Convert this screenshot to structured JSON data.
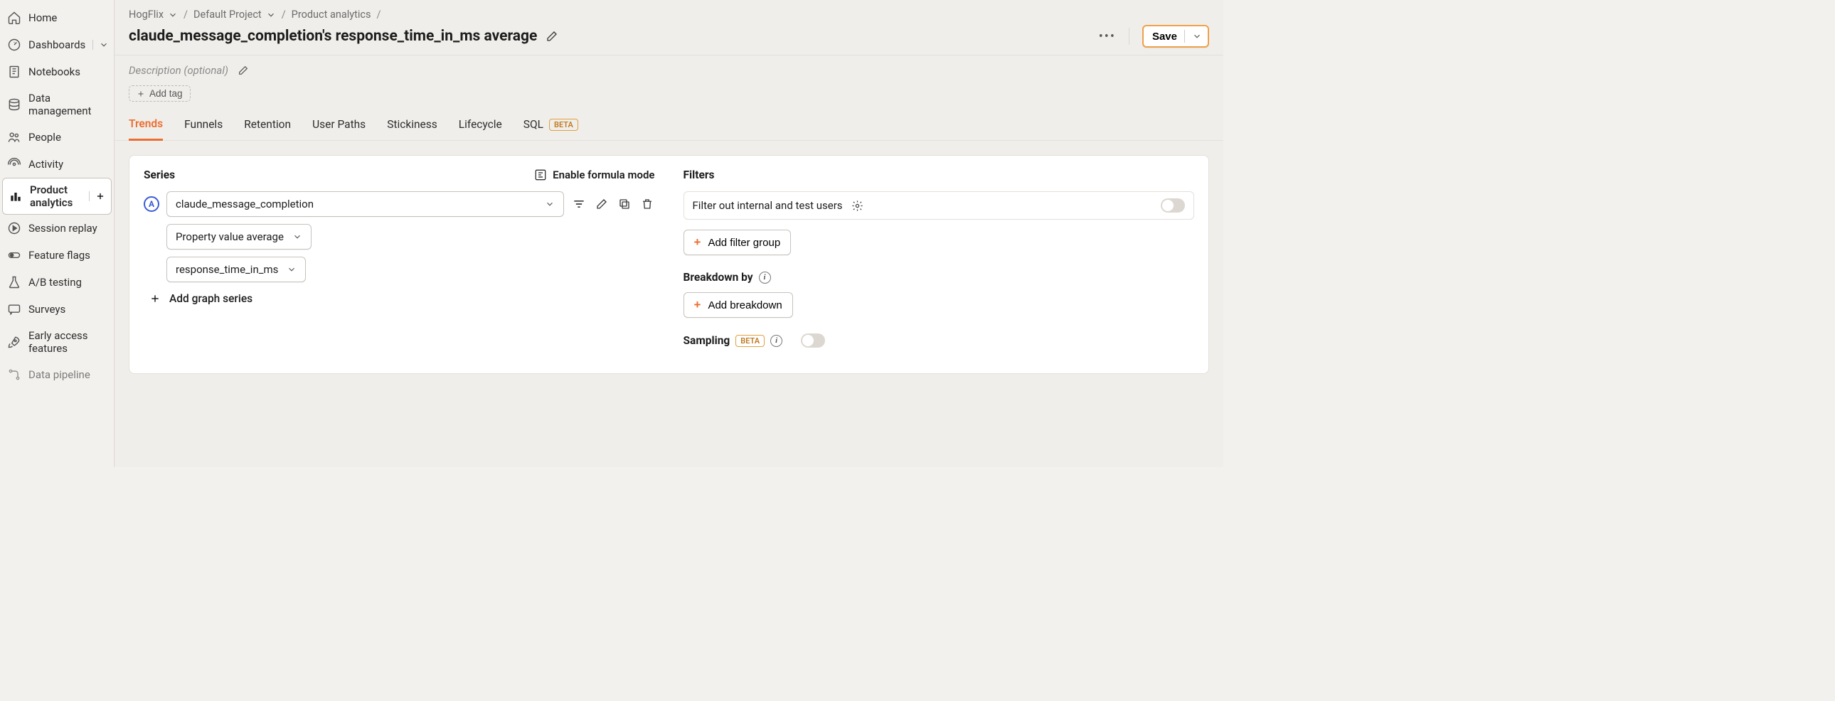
{
  "sidebar": {
    "items": [
      {
        "label": "Home"
      },
      {
        "label": "Dashboards"
      },
      {
        "label": "Notebooks"
      },
      {
        "label": "Data management"
      },
      {
        "label": "People"
      },
      {
        "label": "Activity"
      },
      {
        "label": "Product analytics"
      },
      {
        "label": "Session replay"
      },
      {
        "label": "Feature flags"
      },
      {
        "label": "A/B testing"
      },
      {
        "label": "Surveys"
      },
      {
        "label": "Early access features"
      },
      {
        "label": "Data pipeline"
      }
    ]
  },
  "breadcrumb": {
    "org": "HogFlix",
    "project": "Default Project",
    "section": "Product analytics"
  },
  "page": {
    "title": "claude_message_completion's response_time_in_ms average",
    "description_placeholder": "Description (optional)",
    "add_tag": "Add tag",
    "save": "Save"
  },
  "tabs": [
    "Trends",
    "Funnels",
    "Retention",
    "User Paths",
    "Stickiness",
    "Lifecycle",
    "SQL"
  ],
  "tabs_beta_badge": "BETA",
  "series": {
    "heading": "Series",
    "formula_toggle": "Enable formula mode",
    "letter": "A",
    "event": "claude_message_completion",
    "aggregation": "Property value average",
    "property": "response_time_in_ms",
    "add_series": "Add graph series"
  },
  "filters": {
    "heading": "Filters",
    "internal_toggle": "Filter out internal and test users",
    "add_filter_group": "Add filter group",
    "breakdown_heading": "Breakdown by",
    "add_breakdown": "Add breakdown",
    "sampling_heading": "Sampling",
    "sampling_badge": "BETA"
  }
}
